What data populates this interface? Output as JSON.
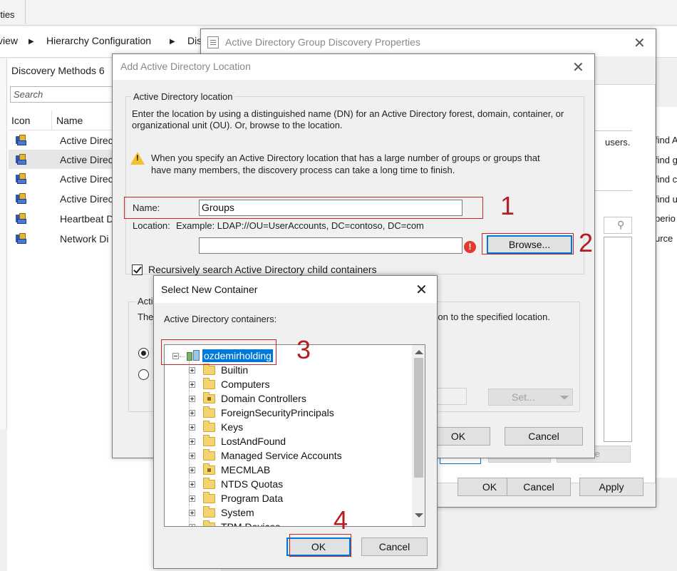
{
  "console": {
    "top_tab": "rties",
    "breadcrumb": {
      "items": [
        "view",
        "Hierarchy Configuration",
        "Dis"
      ]
    },
    "content_title": "Discovery Methods 6",
    "search_placeholder": "Search",
    "columns": {
      "icon": "Icon",
      "name": "Name"
    },
    "rows": [
      {
        "name": "Active Direc",
        "selected": false
      },
      {
        "name": "Active Direc",
        "selected": true
      },
      {
        "name": "Active Direc",
        "selected": false
      },
      {
        "name": "Active Direc",
        "selected": false
      },
      {
        "name": "Heartbeat D",
        "selected": false
      },
      {
        "name": "Network Di",
        "selected": false
      }
    ],
    "right_fragments": [
      "find A",
      "find g",
      "find c",
      "find u",
      "perio",
      "urce"
    ]
  },
  "group_discovery": {
    "title": "Active Directory Group Discovery Properties",
    "partial_text_users": "users.",
    "delete_label": "ete",
    "ok_label": "OK",
    "cancel_label": "Cancel",
    "apply_label": "Apply"
  },
  "add_location": {
    "title": "Add Active Directory Location",
    "group_label": "Active Directory location",
    "description": [
      "Enter the location by using a distinguished name (DN) for an Active Directory forest, domain, container, or",
      "organizational unit (OU). Or, browse to the location."
    ],
    "warning": [
      "When you specify an Active Directory location that has a large number of groups or groups that",
      "have many members, the discovery process can take a long time to finish."
    ],
    "name_label": "Name:",
    "name_value": "Groups",
    "location_label": "Location:",
    "location_example": "Example: LDAP://OU=UserAccounts, DC=contoso, DC=com",
    "location_value": "",
    "browse_label": "Browse...",
    "recursive_label": "Recursively search Active Directory child containers",
    "recursive_checked": true,
    "group2_label": "Acti",
    "group2_text_left": "The",
    "group2_text_right": "sion to the specified location.",
    "set_label": "Set...",
    "ok_label": "OK",
    "cancel_label": "Cancel"
  },
  "select_container": {
    "title": "Select New Container",
    "label": "Active Directory containers:",
    "root": "ozdemirholding",
    "children": [
      "Builtin",
      "Computers",
      "Domain Controllers",
      "ForeignSecurityPrincipals",
      "Keys",
      "LostAndFound",
      "Managed Service Accounts",
      "MECMLAB",
      "NTDS Quotas",
      "Program Data",
      "System",
      "TPM Devices"
    ],
    "ok_label": "OK",
    "cancel_label": "Cancel"
  },
  "annotations": [
    "1",
    "2",
    "3",
    "4"
  ],
  "colors": {
    "accent": "#0078d7",
    "callout": "#c0262b",
    "selection": "#0078d7"
  }
}
